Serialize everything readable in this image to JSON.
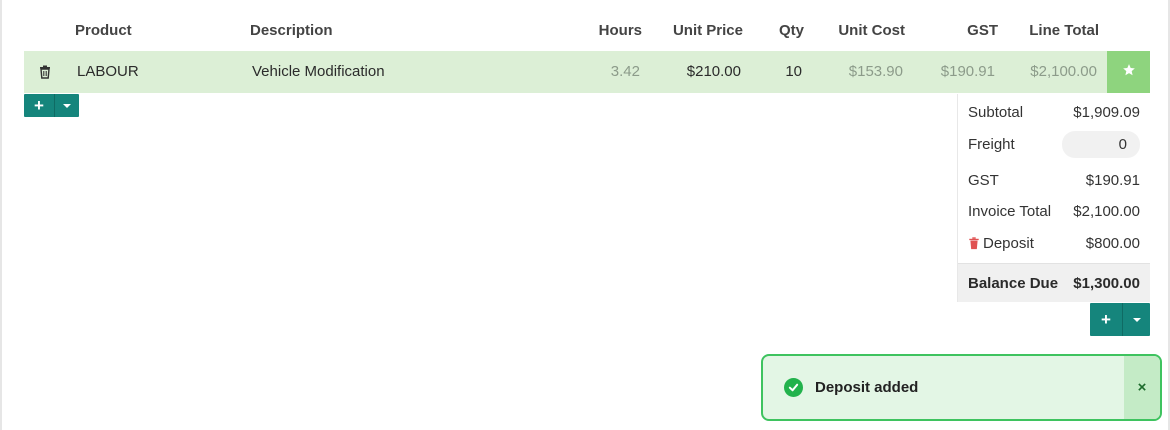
{
  "table": {
    "headers": {
      "product": "Product",
      "description": "Description",
      "hours": "Hours",
      "unit_price": "Unit Price",
      "qty": "Qty",
      "unit_cost": "Unit Cost",
      "gst": "GST",
      "line_total": "Line Total"
    },
    "rows": [
      {
        "product": "LABOUR",
        "description": "Vehicle Modification",
        "hours": "3.42",
        "unit_price": "$210.00",
        "qty": "10",
        "unit_cost": "$153.90",
        "gst": "$190.91",
        "line_total": "$2,100.00"
      }
    ]
  },
  "totals": {
    "subtotal_label": "Subtotal",
    "subtotal_value": "$1,909.09",
    "freight_label": "Freight",
    "freight_value": "0",
    "gst_label": "GST",
    "gst_value": "$190.91",
    "invoice_total_label": "Invoice Total",
    "invoice_total_value": "$2,100.00",
    "deposit_label": "Deposit",
    "deposit_value": "$800.00",
    "balance_due_label": "Balance Due",
    "balance_due_value": "$1,300.00"
  },
  "toast": {
    "message": "Deposit added",
    "close_label": "×"
  },
  "buttons": {
    "add_symbol": "+"
  },
  "icons": {
    "row_delete": "trash-icon",
    "row_star": "star-icon",
    "deposit_delete": "trash-icon",
    "toast_status": "check-circle-icon",
    "dropdown": "caret-down-icon"
  },
  "colors": {
    "row_highlight": "#dcefd6",
    "star_button": "#8ed47e",
    "primary": "#15857c",
    "toast_border": "#3ec35f",
    "toast_bg": "#e3f6e5",
    "danger": "#e05252"
  }
}
